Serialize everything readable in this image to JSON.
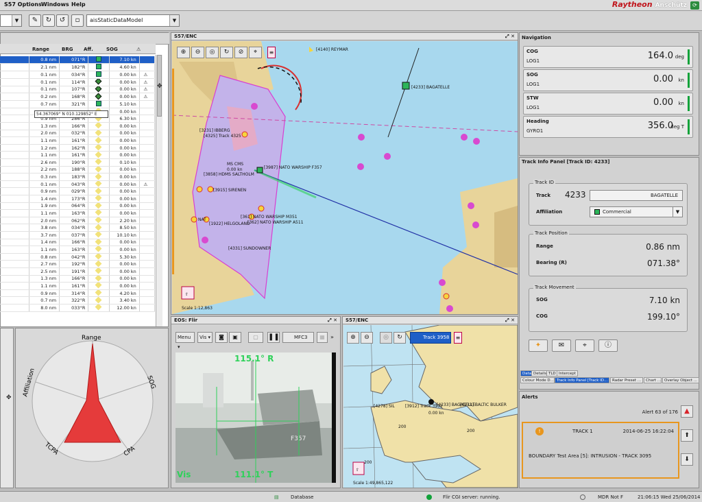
{
  "menu": {
    "items": [
      "S57 Options",
      "Windows",
      "Help"
    ],
    "brand": "Raytheon",
    "brand_sub": "Anschütz"
  },
  "toolbar": {
    "combo_value": "aisStaticDataModel"
  },
  "track_table": {
    "headers": [
      "Range",
      "BRG",
      "Aff.",
      "SOG"
    ],
    "tooltip": "54.367069° N 010.129852° E",
    "rows": [
      {
        "range": "0.8 nm",
        "brg": "071°R",
        "aff": "green",
        "sog": "7.10 kn",
        "warn": false,
        "sel": true
      },
      {
        "range": "2.1 nm",
        "brg": "182°R",
        "aff": "green",
        "sog": "4.60 kn",
        "warn": false
      },
      {
        "range": "0.1 nm",
        "brg": "034°R",
        "aff": "green",
        "sog": "0.00 kn",
        "warn": true
      },
      {
        "range": "0.1 nm",
        "brg": "114°R",
        "aff": "diamond",
        "sog": "0.00 kn",
        "warn": true
      },
      {
        "range": "0.1 nm",
        "brg": "107°R",
        "aff": "diamond",
        "sog": "0.00 kn",
        "warn": true
      },
      {
        "range": "0.2 nm",
        "brg": "168°R",
        "aff": "diamond",
        "sog": "0.00 kn",
        "warn": true
      },
      {
        "range": "0.7 nm",
        "brg": "321°R",
        "aff": "green",
        "sog": "5.10 kn",
        "warn": false
      },
      {
        "range": "",
        "brg": "",
        "aff": "yellow",
        "sog": "0.00 kn",
        "warn": false
      },
      {
        "range": "0.9 nm",
        "brg": "286°R",
        "aff": "yellow",
        "sog": "6.30 kn",
        "warn": false
      },
      {
        "range": "1.3 nm",
        "brg": "166°R",
        "aff": "yellow",
        "sog": "0.00 kn",
        "warn": false
      },
      {
        "range": "2.0 nm",
        "brg": "032°R",
        "aff": "yellow",
        "sog": "0.00 kn",
        "warn": false
      },
      {
        "range": "1.1 nm",
        "brg": "161°R",
        "aff": "yellow",
        "sog": "0.00 kn",
        "warn": false
      },
      {
        "range": "1.2 nm",
        "brg": "162°R",
        "aff": "yellow",
        "sog": "0.00 kn",
        "warn": false
      },
      {
        "range": "1.1 nm",
        "brg": "161°R",
        "aff": "yellow",
        "sog": "0.00 kn",
        "warn": false
      },
      {
        "range": "2.6 nm",
        "brg": "190°R",
        "aff": "yellow",
        "sog": "0.10 kn",
        "warn": false
      },
      {
        "range": "2.2 nm",
        "brg": "188°R",
        "aff": "yellow",
        "sog": "0.00 kn",
        "warn": false
      },
      {
        "range": "0.3 nm",
        "brg": "183°R",
        "aff": "yellow",
        "sog": "0.00 kn",
        "warn": false
      },
      {
        "range": "0.1 nm",
        "brg": "043°R",
        "aff": "yellow",
        "sog": "0.00 kn",
        "warn": true
      },
      {
        "range": "0.9 nm",
        "brg": "029°R",
        "aff": "yellow",
        "sog": "0.00 kn",
        "warn": false
      },
      {
        "range": "1.4 nm",
        "brg": "173°R",
        "aff": "yellow",
        "sog": "0.00 kn",
        "warn": false
      },
      {
        "range": "1.9 nm",
        "brg": "064°R",
        "aff": "yellow",
        "sog": "0.00 kn",
        "warn": false
      },
      {
        "range": "1.1 nm",
        "brg": "163°R",
        "aff": "yellow",
        "sog": "0.00 kn",
        "warn": false
      },
      {
        "range": "2.0 nm",
        "brg": "062°R",
        "aff": "yellow",
        "sog": "2.20 kn",
        "warn": false
      },
      {
        "range": "3.8 nm",
        "brg": "034°R",
        "aff": "yellow",
        "sog": "8.50 kn",
        "warn": false
      },
      {
        "range": "3.7 nm",
        "brg": "037°R",
        "aff": "yellow",
        "sog": "10.10 kn",
        "warn": false
      },
      {
        "range": "1.4 nm",
        "brg": "166°R",
        "aff": "yellow",
        "sog": "0.00 kn",
        "warn": false
      },
      {
        "range": "1.1 nm",
        "brg": "163°R",
        "aff": "yellow",
        "sog": "0.00 kn",
        "warn": false
      },
      {
        "range": "0.8 nm",
        "brg": "042°R",
        "aff": "yellow",
        "sog": "5.30 kn",
        "warn": false
      },
      {
        "range": "2.7 nm",
        "brg": "192°R",
        "aff": "yellow",
        "sog": "0.00 kn",
        "warn": false
      },
      {
        "range": "2.5 nm",
        "brg": "191°R",
        "aff": "yellow",
        "sog": "0.00 kn",
        "warn": false
      },
      {
        "range": "1.3 nm",
        "brg": "166°R",
        "aff": "yellow",
        "sog": "0.00 kn",
        "warn": false
      },
      {
        "range": "1.1 nm",
        "brg": "161°R",
        "aff": "yellow",
        "sog": "0.00 kn",
        "warn": false
      },
      {
        "range": "0.9 nm",
        "brg": "314°R",
        "aff": "yellow",
        "sog": "4.20 kn",
        "warn": false
      },
      {
        "range": "0.7 nm",
        "brg": "322°R",
        "aff": "yellow",
        "sog": "3.40 kn",
        "warn": false
      },
      {
        "range": "8.0 nm",
        "brg": "033°R",
        "aff": "yellow",
        "sog": "12.00 kn",
        "warn": false
      }
    ]
  },
  "radar_plot": {
    "labels": [
      "Range",
      "SOG",
      "CPA",
      "TCPA",
      "Affiliation"
    ]
  },
  "chart_main": {
    "title": "S57/ENC",
    "scale": "Scale 1:12,863",
    "labels": {
      "reymar": "[4140] REYMAR",
      "bagatelle": "[4233] BAGATELLE",
      "ibberg": "[3231] IBBERG",
      "track4325": "[4325] Track 4325",
      "nato357": "[3987] NATO WARSHIP F357",
      "hdms": "[3858] HDMS SALTHOLM",
      "sirenen": "[3915] SIRENEN",
      "nato351": "[361] NATO WARSHIP M351",
      "nato511": "[362] NATO WARSHIP A511",
      "ms_cms": "MS CMS",
      "helgoland": "[1922] HELGOLAND",
      "sundowner": "[4331] SUNDOWNER",
      "nat_short": "NAT",
      "zero_kn": "0.00 kn"
    }
  },
  "flir": {
    "title": "EOS: Flir",
    "menu": "Menu",
    "vis_btn": "Vis",
    "mfc": "MFC3",
    "bearing_top": "115.1° R",
    "bearing_bottom": "111.1° T",
    "mode": "Vis",
    "hull": "F357"
  },
  "chart_small": {
    "title": "S57/ENC",
    "track_btn": "Track 3958",
    "scale": "Scale 1:49,865,122",
    "grid": [
      "200",
      "200",
      "200"
    ],
    "labels": {
      "l4278": "[4278] SIL",
      "l3912": "[3912] Track 3912",
      "bagatelle_small": "[4233] BAGATELLE",
      "bulker": "[4233] BALTIC BULKER",
      "kn": "0.00 kn"
    }
  },
  "navigation": {
    "title": "Navigation",
    "items": [
      {
        "label": "COG",
        "source": "LOG1",
        "value": "164.0",
        "unit": "deg"
      },
      {
        "label": "SOG",
        "source": "LOG1",
        "value": "0.00",
        "unit": "kn"
      },
      {
        "label": "STW",
        "source": "LOG1",
        "value": "0.00",
        "unit": "kn"
      },
      {
        "label": "Heading",
        "source": "GYRO1",
        "value": "356.0",
        "unit": "deg T"
      }
    ]
  },
  "track_info": {
    "title": "Track Info Panel [Track ID: 4233]",
    "track_id_group": "Track ID",
    "track_label": "Track",
    "track_value": "4233",
    "track_name": "BAGATELLE",
    "affiliation_label": "Affiliation",
    "affiliation_value": "Commercial",
    "position_group": "Track Position",
    "range_label": "Range",
    "range_value": "0.86 nm",
    "bearing_label": "Bearing (R)",
    "bearing_value": "071.38°",
    "movement_group": "Track Movement",
    "sog_label": "SOG",
    "sog_value": "7.10 kn",
    "cog_label": "COG",
    "cog_value": "199.10°",
    "tabs": [
      "Data",
      "Details",
      "TLD",
      "Intercept"
    ],
    "bottom_tabs": [
      "Colour Mode D...",
      "Track Info Panel [Track ID...",
      "Radar Preset ...",
      "Chart ...",
      "Overlay Object ..."
    ]
  },
  "alerts": {
    "title": "Alerts",
    "counter": "Alert 63 of 176",
    "track": "TRACK 1",
    "time": "2014-06-25 16:22:04",
    "message": "BOUNDARY Test Area [5]: INTRUSION - TRACK 3095"
  },
  "status": {
    "database": "Database",
    "flir": "Flir CGI server: running.",
    "mdr": "MDR Not F",
    "clock": "21:06:15 Wed 25/06/2014"
  },
  "colors": {
    "accent_blue": "#1f5fc7",
    "nav_green": "#11a23a",
    "alert_orange": "#e8961e",
    "alert_red": "#d8232a",
    "sea": "#a8d8ee",
    "land": "#e8d49a"
  }
}
